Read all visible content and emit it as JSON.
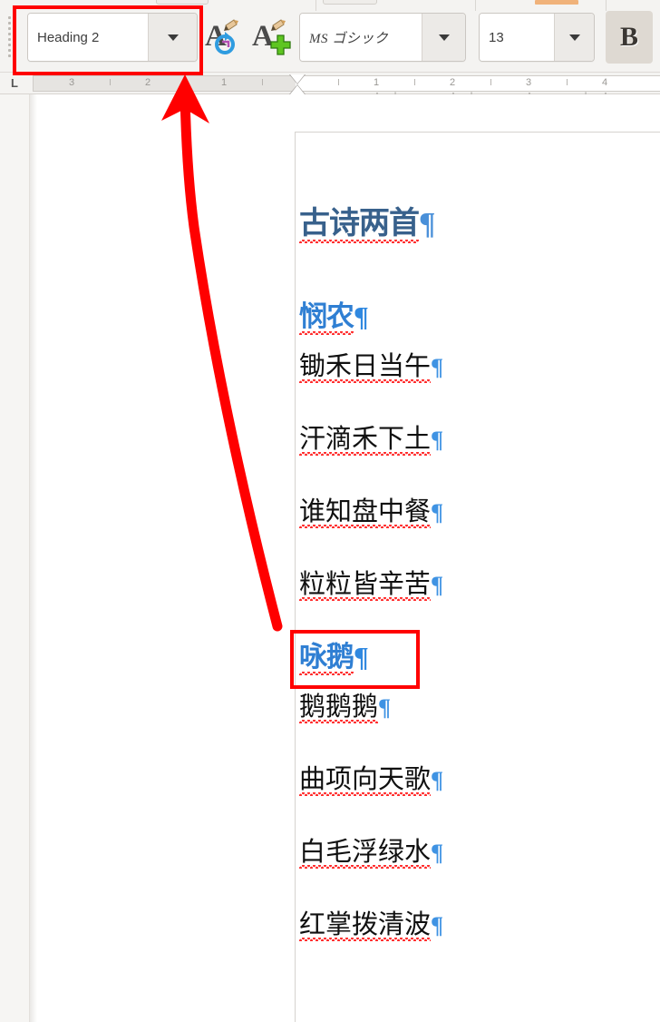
{
  "toolbar": {
    "style_combo": {
      "value": "Heading 2",
      "dropdown_icon": "chevron-down-icon"
    },
    "update_style_button": {
      "icon": "update-style-A-icon",
      "glyph": "A"
    },
    "new_style_button": {
      "icon": "new-style-A-plus-icon",
      "glyph": "A"
    },
    "font_combo": {
      "value": "MS ゴシック",
      "dropdown_icon": "chevron-down-icon"
    },
    "size_combo": {
      "value": "13",
      "dropdown_icon": "chevron-down-icon"
    },
    "bold_button": {
      "label": "B",
      "state": "active"
    }
  },
  "ruler": {
    "corner_icon": "tab-left-icon",
    "corner_glyph": "L",
    "left_numbers": [
      "3",
      "2",
      "1"
    ],
    "right_numbers": [
      "1",
      "2",
      "3",
      "4"
    ],
    "indent_marker": "hourglass-indent-marker"
  },
  "document": {
    "title": {
      "text": "古诗两首",
      "pilcrow": "¶",
      "color": "#38618c"
    },
    "sections": [
      {
        "heading": {
          "text": "悯农",
          "pilcrow": "¶",
          "color": "#2f7fd3"
        },
        "lines": [
          {
            "text": "锄禾日当午",
            "pilcrow": "¶"
          },
          {
            "text": "汗滴禾下土",
            "pilcrow": "¶"
          },
          {
            "text": "谁知盘中餐",
            "pilcrow": "¶"
          },
          {
            "text": "粒粒皆辛苦",
            "pilcrow": "¶"
          }
        ]
      },
      {
        "heading": {
          "text": "咏鹅",
          "pilcrow": "¶",
          "color": "#2f7fd3"
        },
        "lines": [
          {
            "text": "鹅鹅鹅",
            "pilcrow": "¶"
          },
          {
            "text": "曲项向天歌",
            "pilcrow": "¶"
          },
          {
            "text": "白毛浮绿水",
            "pilcrow": "¶"
          },
          {
            "text": "红掌拨清波",
            "pilcrow": "¶"
          }
        ]
      }
    ]
  },
  "annotations": {
    "highlight_color": "#ff0000",
    "style_combo_box": "red-rectangle-around-style-dropdown",
    "yonge_heading_box": "red-rectangle-around-yong-e-heading",
    "arrow": "red-curved-arrow-from-heading-to-style-dropdown"
  }
}
